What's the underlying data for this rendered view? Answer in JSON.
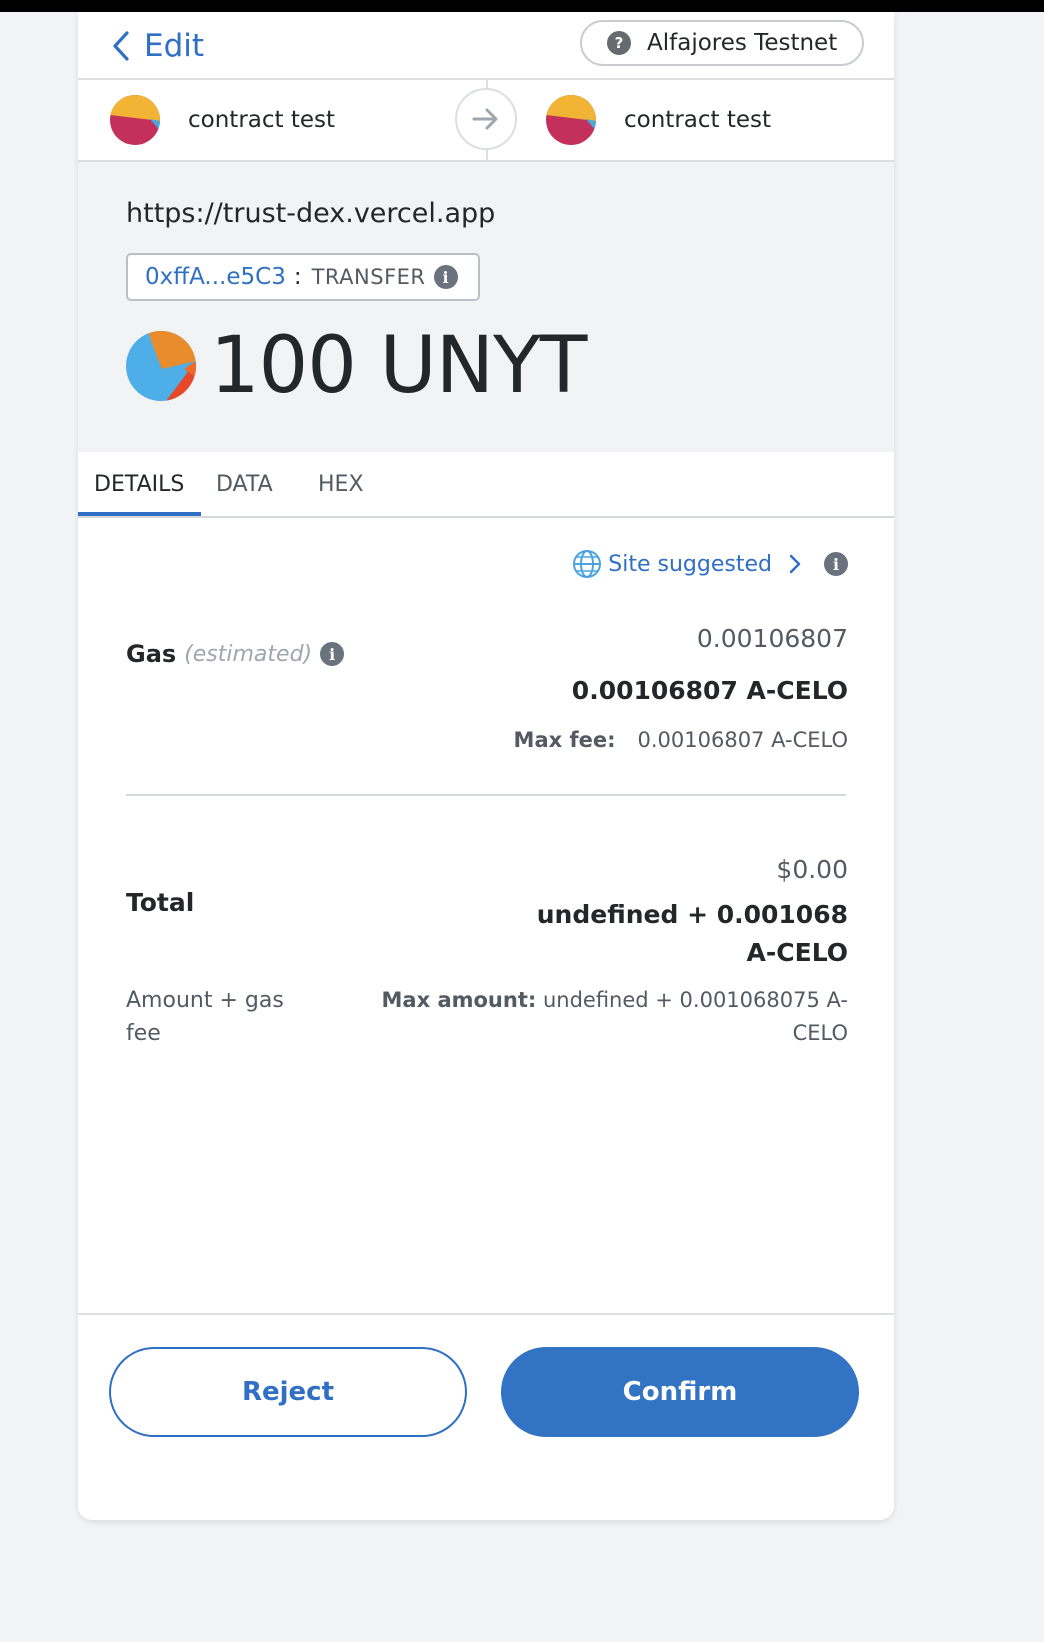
{
  "header": {
    "back_label": "Edit",
    "network_label": "Alfajores Testnet",
    "network_icon": "question-icon"
  },
  "accounts": {
    "from_name": "contract test",
    "to_name": "contract test"
  },
  "summary": {
    "origin": "https://trust-dex.vercel.app",
    "contract_address": "0xffA...e5C3",
    "separator": ":",
    "method": "TRANSFER",
    "amount": "100 UNYT"
  },
  "tabs": [
    {
      "label": "DETAILS",
      "active": true
    },
    {
      "label": "DATA",
      "active": false
    },
    {
      "label": "HEX",
      "active": false
    }
  ],
  "gas": {
    "site_suggested": "Site suggested",
    "label": "Gas",
    "estimated": "(estimated)",
    "fiat": "0.00106807",
    "native": "0.00106807 A-CELO",
    "max_fee_label": "Max fee:",
    "max_fee_value": "0.00106807 A-CELO"
  },
  "total": {
    "label": "Total",
    "fiat": "$0.00",
    "native": "undefined + 0.001068 A-CELO",
    "amount_gas_label": "Amount + gas fee",
    "max_amount_label": "Max amount:",
    "max_amount_value": "undefined + 0.001068075 A-CELO"
  },
  "footer": {
    "reject_label": "Reject",
    "confirm_label": "Confirm"
  },
  "colors": {
    "accent": "#2f6fc4",
    "confirm_bg": "#3373c3",
    "summary_bg": "#f2f3f4"
  }
}
